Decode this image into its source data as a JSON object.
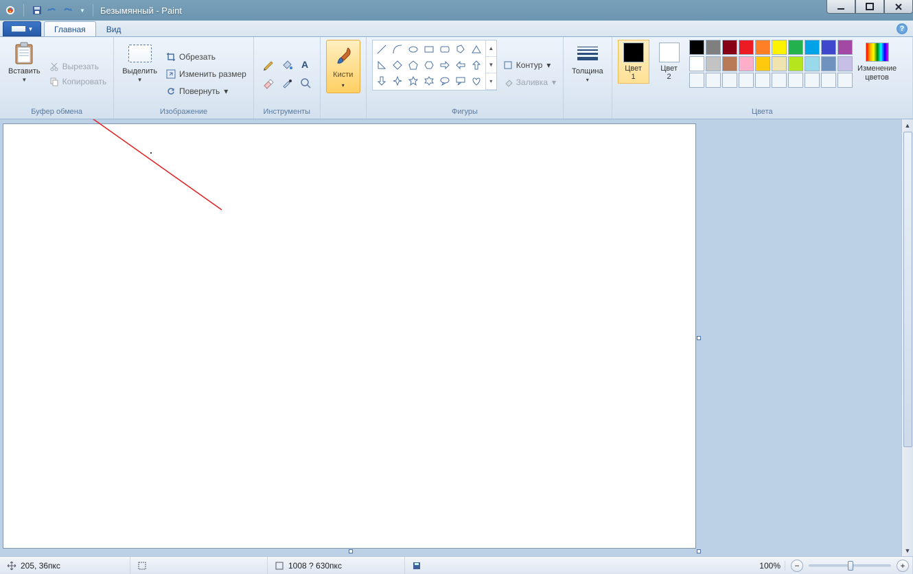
{
  "title": "Безымянный - Paint",
  "tabs": {
    "home": "Главная",
    "view": "Вид"
  },
  "clipboard": {
    "paste": "Вставить",
    "cut": "Вырезать",
    "copy": "Копировать",
    "group": "Буфер обмена"
  },
  "image": {
    "select": "Выделить",
    "crop": "Обрезать",
    "resize": "Изменить размер",
    "rotate": "Повернуть",
    "group": "Изображение"
  },
  "tools": {
    "group": "Инструменты"
  },
  "brushes": {
    "label": "Кисти"
  },
  "shapes": {
    "outline": "Контур",
    "fill": "Заливка",
    "group": "Фигуры"
  },
  "size": {
    "label": "Толщина"
  },
  "colors": {
    "color1": "Цвет\n1",
    "color2": "Цвет\n2",
    "edit": "Изменение\nцветов",
    "group": "Цвета"
  },
  "palette": [
    "#000000",
    "#7f7f7f",
    "#880015",
    "#ed1c24",
    "#ff7f27",
    "#fff200",
    "#22b14c",
    "#00a2e8",
    "#3f48cc",
    "#a349a4",
    "#ffffff",
    "#c3c3c3",
    "#b97a57",
    "#ffaec9",
    "#ffc90e",
    "#efe4b0",
    "#b5e61d",
    "#99d9ea",
    "#7092be",
    "#c8bfe7"
  ],
  "status": {
    "cursor": "205, 36пкс",
    "selection_size": "",
    "canvas_size": "1008 ? 630пкс",
    "file_size": "",
    "zoom": "100%"
  }
}
